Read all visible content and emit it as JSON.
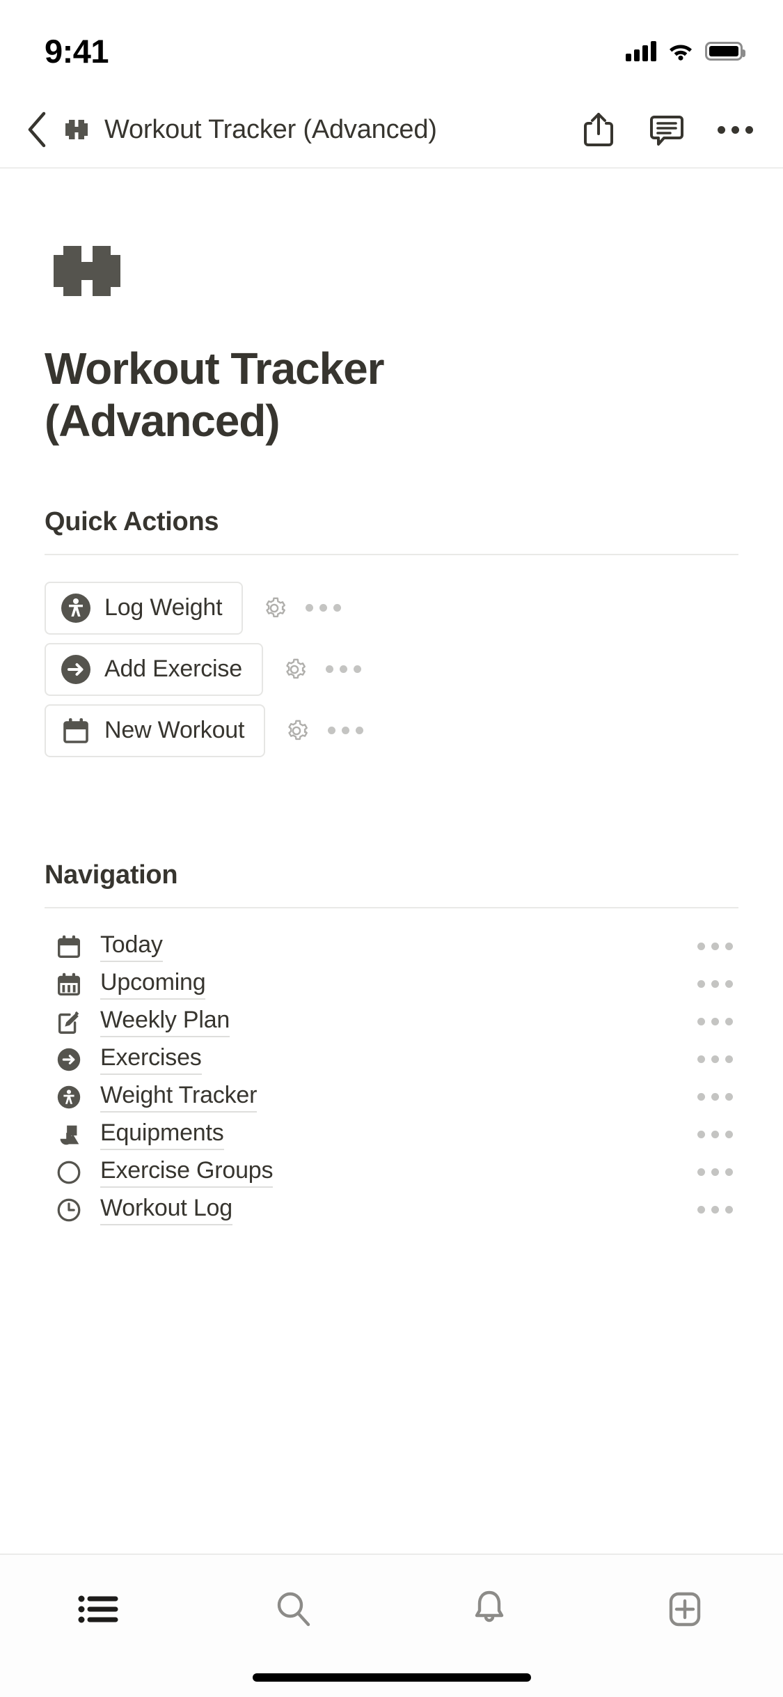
{
  "status_bar": {
    "time": "9:41",
    "icons": [
      "cellular-signal-icon",
      "wifi-icon",
      "battery-icon"
    ]
  },
  "topbar": {
    "back_icon": "chevron-left-icon",
    "page_icon": "dumbbell-icon",
    "title": "Workout Tracker (Advanced)",
    "actions": [
      {
        "name": "share-icon"
      },
      {
        "name": "comment-icon"
      },
      {
        "name": "more-options-icon"
      }
    ]
  },
  "page": {
    "icon": "dumbbell-icon",
    "title": "Workout Tracker (Advanced)"
  },
  "quick_actions": {
    "heading": "Quick Actions",
    "items": [
      {
        "label": "Log Weight",
        "icon": "person-circle-icon",
        "gear": "gear-icon",
        "more": "more-options-icon"
      },
      {
        "label": "Add Exercise",
        "icon": "arrow-right-circle-icon",
        "gear": "gear-icon",
        "more": "more-options-icon"
      },
      {
        "label": "New Workout",
        "icon": "calendar-icon",
        "gear": "gear-icon",
        "more": "more-options-icon"
      }
    ]
  },
  "navigation": {
    "heading": "Navigation",
    "items": [
      {
        "label": "Today",
        "icon": "calendar-icon",
        "more": "more-options-icon"
      },
      {
        "label": "Upcoming",
        "icon": "calendar-week-icon",
        "more": "more-options-icon"
      },
      {
        "label": "Weekly Plan",
        "icon": "edit-square-icon",
        "more": "more-options-icon"
      },
      {
        "label": "Exercises",
        "icon": "arrow-right-circle-icon",
        "more": "more-options-icon"
      },
      {
        "label": "Weight Tracker",
        "icon": "person-circle-icon",
        "more": "more-options-icon"
      },
      {
        "label": "Equipments",
        "icon": "shapes-icon",
        "more": "more-options-icon"
      },
      {
        "label": "Exercise Groups",
        "icon": "circle-outline-icon",
        "more": "more-options-icon"
      },
      {
        "label": "Workout Log",
        "icon": "clock-icon",
        "more": "more-options-icon"
      }
    ]
  },
  "tabbar": {
    "items": [
      {
        "name": "list-tab",
        "icon": "list-icon"
      },
      {
        "name": "search-tab",
        "icon": "search-icon"
      },
      {
        "name": "notifications-tab",
        "icon": "bell-icon"
      },
      {
        "name": "create-tab",
        "icon": "plus-square-icon"
      }
    ]
  },
  "colors": {
    "text": "#37352f",
    "icon_dark": "#55544e",
    "muted": "#c4c4c2",
    "rule": "#e9e9e7"
  }
}
